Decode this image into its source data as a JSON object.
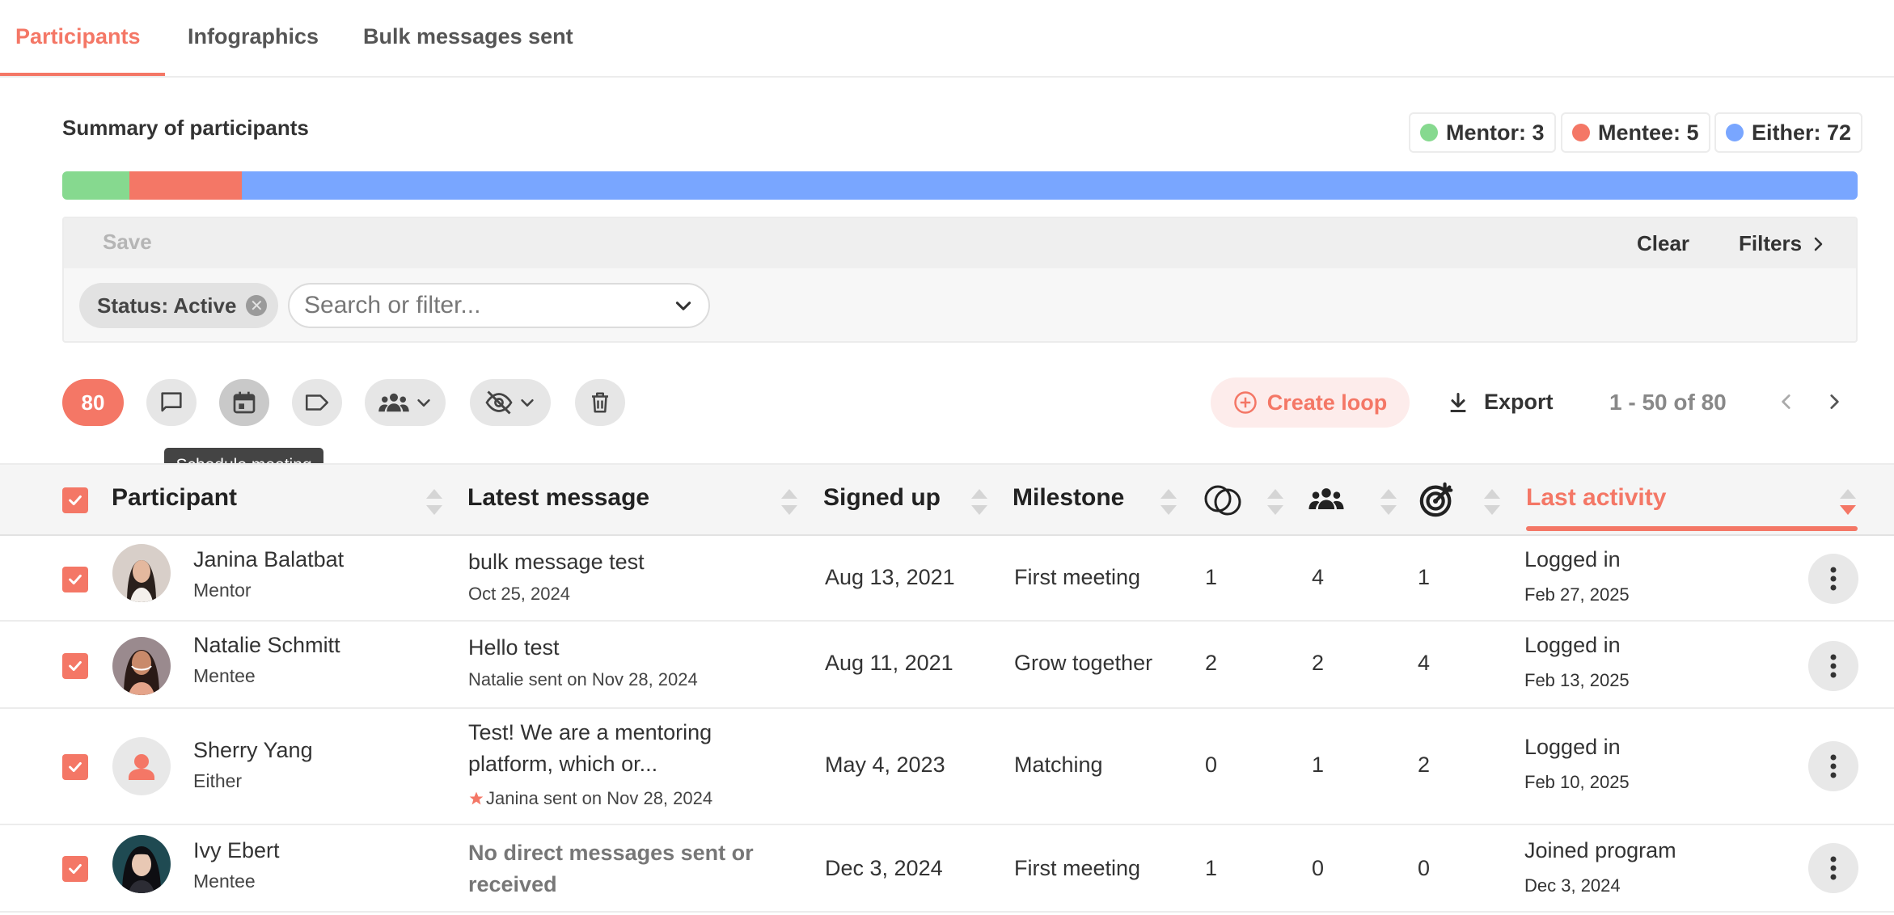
{
  "tabs": [
    {
      "label": "Participants"
    },
    {
      "label": "Infographics"
    },
    {
      "label": "Bulk messages sent"
    }
  ],
  "summary": {
    "title": "Summary of participants",
    "legend": [
      {
        "label": "Mentor: 3",
        "color": "#86d98f"
      },
      {
        "label": "Mentee: 5",
        "color": "#f47766"
      },
      {
        "label": "Either: 72",
        "color": "#79a6ff"
      }
    ],
    "bar": {
      "mentor": 3,
      "mentee": 5,
      "either": 72
    }
  },
  "filters": {
    "save_label": "Save",
    "clear_label": "Clear",
    "filters_label": "Filters",
    "chip_label": "Status: Active",
    "search_placeholder": "Search or filter..."
  },
  "toolbar": {
    "count": "80",
    "tooltip": "Schedule meeting",
    "create_loop_label": "Create loop",
    "export_label": "Export",
    "pagination": "1 - 50 of 80"
  },
  "table": {
    "headers": {
      "participant": "Participant",
      "latest_message": "Latest message",
      "signed_up": "Signed up",
      "milestone": "Milestone",
      "last_activity": "Last activity"
    },
    "rows": [
      {
        "name": "Janina Balatbat",
        "role": "Mentor",
        "message": "bulk message test",
        "message_sub": "Oct 25, 2024",
        "signed_up": "Aug 13, 2021",
        "milestone": "First meeting",
        "c1": "1",
        "c2": "4",
        "c3": "1",
        "activity": "Logged in",
        "activity_date": "Feb 27, 2025"
      },
      {
        "name": "Natalie Schmitt",
        "role": "Mentee",
        "message": "Hello test",
        "message_sub": "Natalie sent on Nov 28, 2024",
        "signed_up": "Aug 11, 2021",
        "milestone": "Grow together",
        "c1": "2",
        "c2": "2",
        "c3": "4",
        "activity": "Logged in",
        "activity_date": "Feb 13, 2025"
      },
      {
        "name": "Sherry Yang",
        "role": "Either",
        "message_line1": "Test! We are a mentoring",
        "message_line2": "platform, which or...",
        "message_sub": "Janina sent on Nov 28, 2024",
        "signed_up": "May 4, 2023",
        "milestone": "Matching",
        "c1": "0",
        "c2": "1",
        "c3": "2",
        "activity": "Logged in",
        "activity_date": "Feb 10, 2025"
      },
      {
        "name": "Ivy Ebert",
        "role": "Mentee",
        "message_line1": "No direct messages sent or",
        "message_line2": "received",
        "signed_up": "Dec 3, 2024",
        "milestone": "First meeting",
        "c1": "1",
        "c2": "0",
        "c3": "0",
        "activity": "Joined program",
        "activity_date": "Dec 3, 2024"
      }
    ]
  }
}
